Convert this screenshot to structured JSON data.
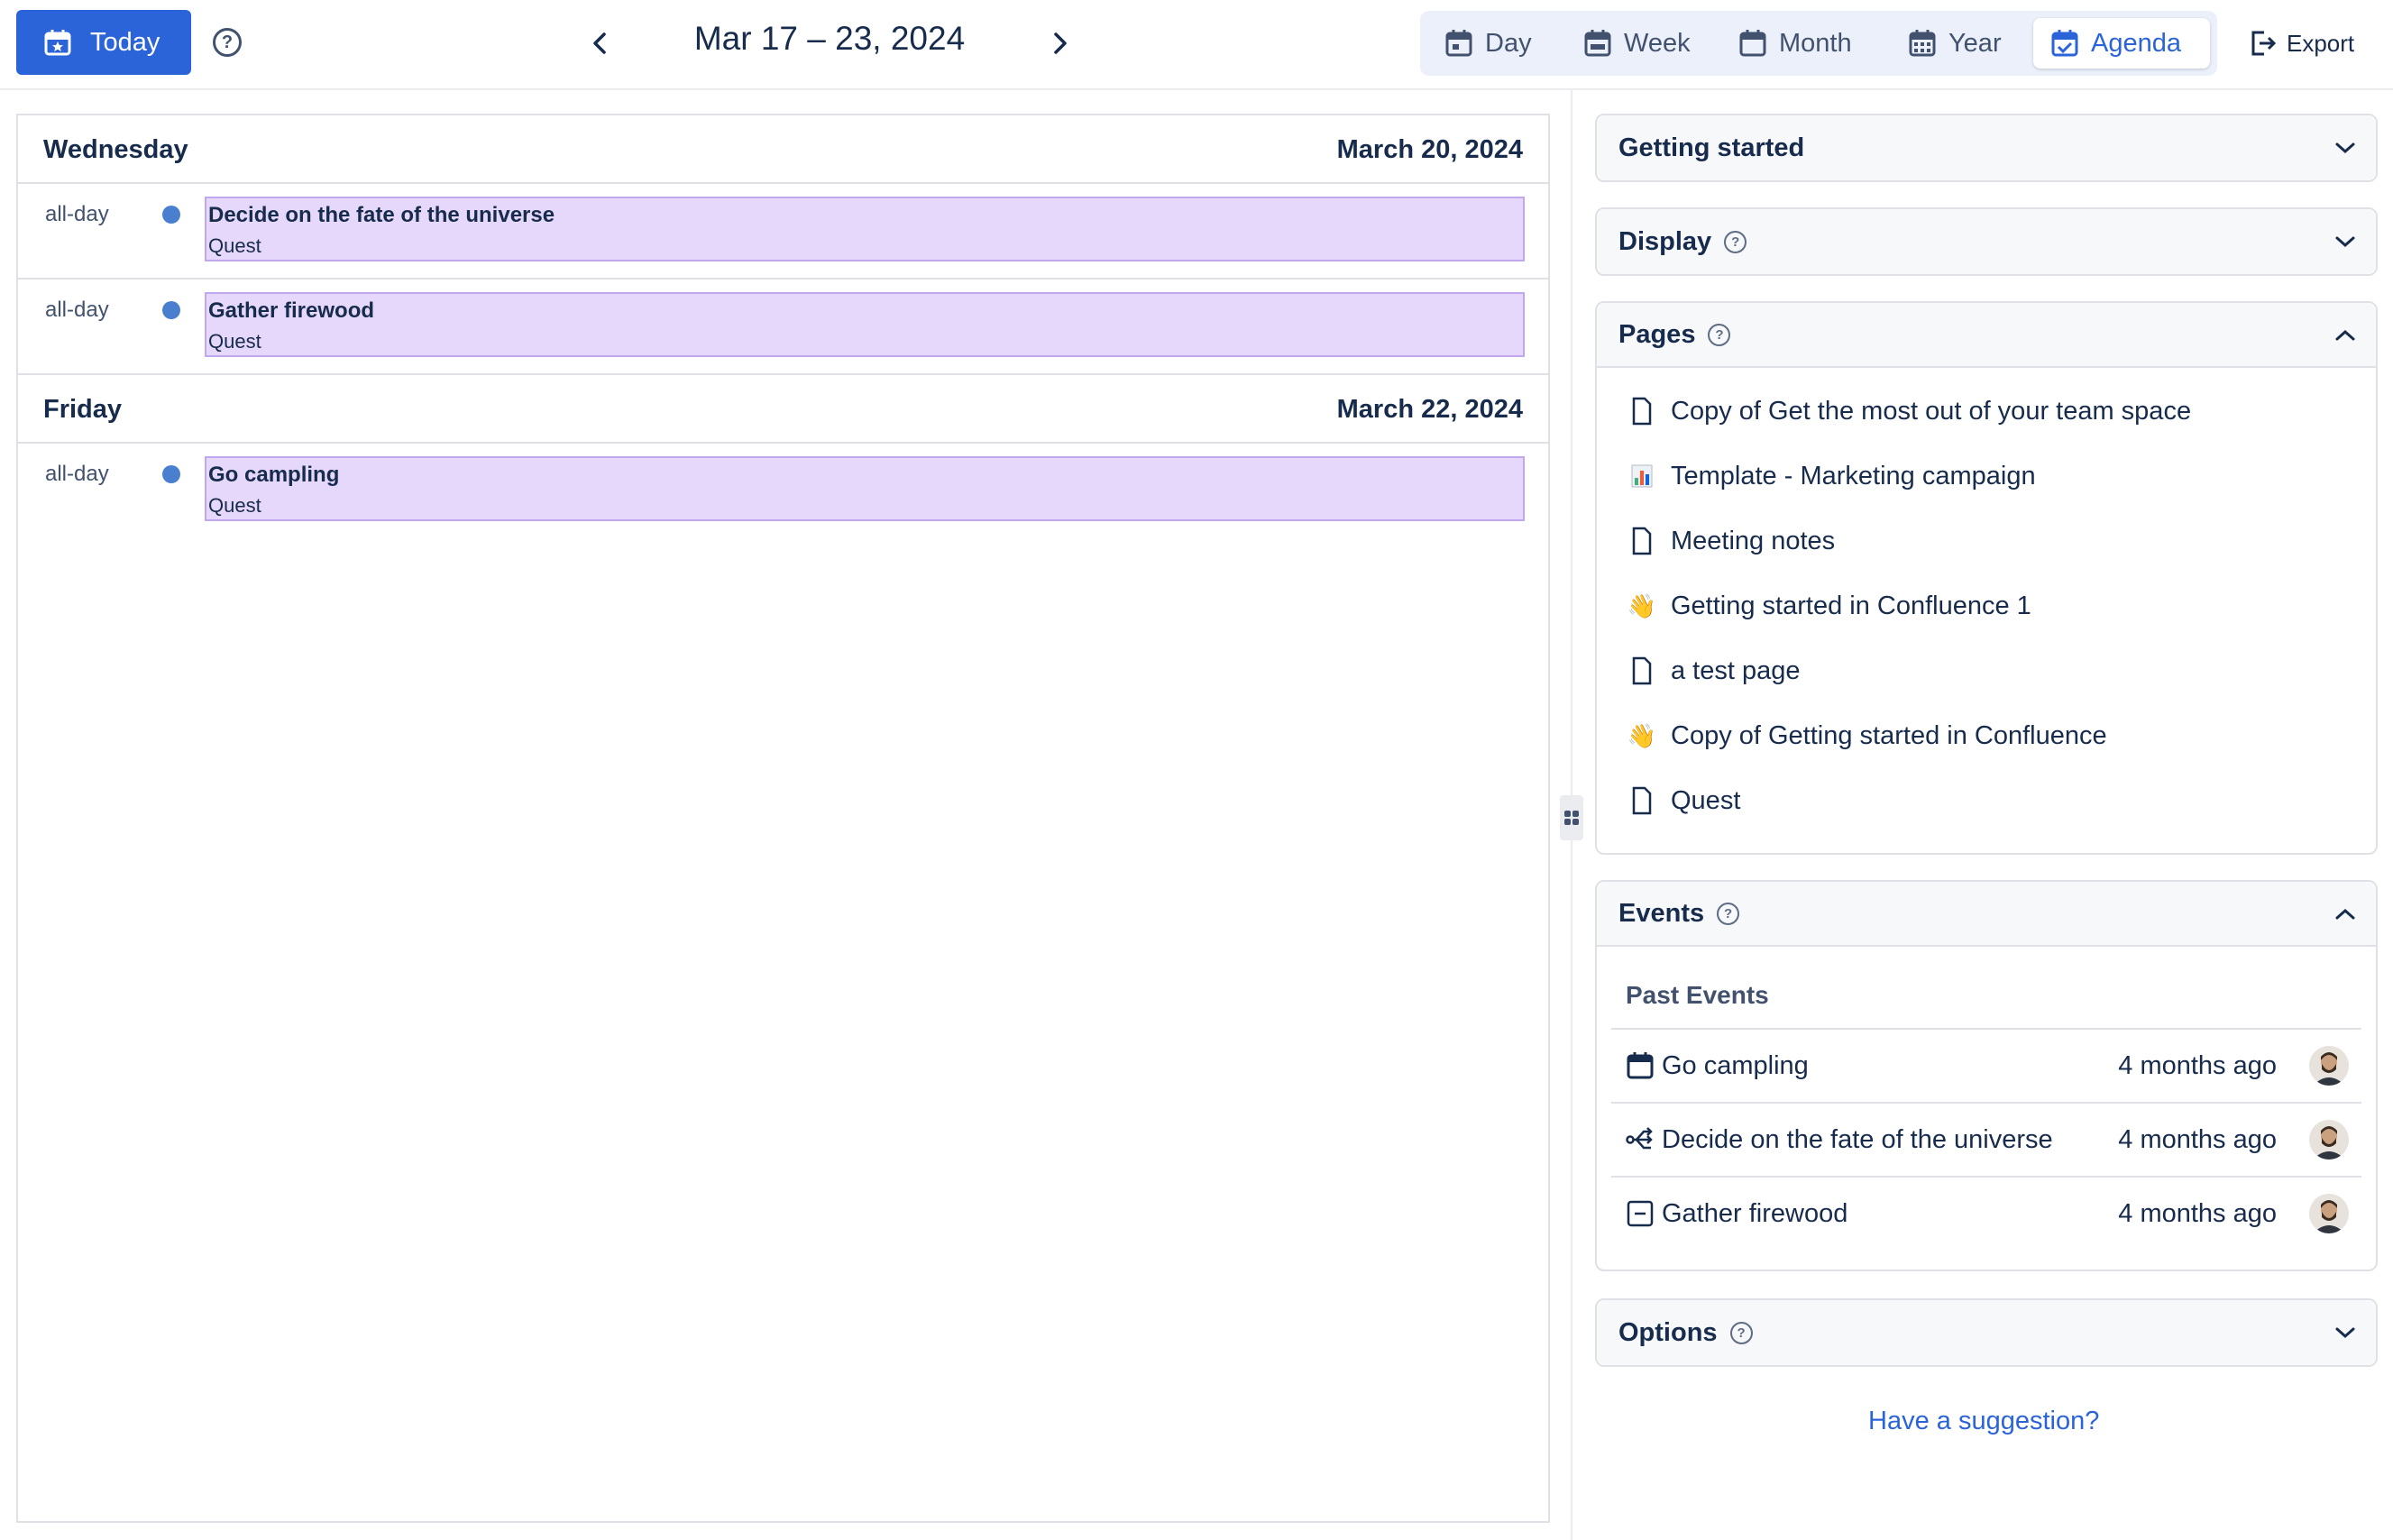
{
  "toolbar": {
    "today_label": "Today",
    "date_range": "Mar 17 – 23, 2024",
    "views": [
      {
        "label": "Day",
        "icon": "calendar-day-icon"
      },
      {
        "label": "Week",
        "icon": "calendar-week-icon"
      },
      {
        "label": "Month",
        "icon": "calendar-month-icon"
      },
      {
        "label": "Year",
        "icon": "calendar-year-icon"
      },
      {
        "label": "Agenda",
        "icon": "calendar-check-icon",
        "active": true
      }
    ],
    "export_label": "Export"
  },
  "agenda": {
    "days": [
      {
        "name": "Wednesday",
        "date": "March 20, 2024",
        "events": [
          {
            "time": "all-day",
            "title": "Decide on the fate of the universe",
            "calendar": "Quest"
          },
          {
            "time": "all-day",
            "title": "Gather firewood",
            "calendar": "Quest"
          }
        ]
      },
      {
        "name": "Friday",
        "date": "March 22, 2024",
        "events": [
          {
            "time": "all-day",
            "title": "Go campling",
            "calendar": "Quest"
          }
        ]
      }
    ]
  },
  "sidebar": {
    "getting_started": {
      "title": "Getting started",
      "expanded": false
    },
    "display": {
      "title": "Display",
      "expanded": false
    },
    "pages": {
      "title": "Pages",
      "expanded": true,
      "items": [
        {
          "label": "Copy of Get the most out of your team space",
          "icon": "page-icon"
        },
        {
          "label": "Template - Marketing campaign",
          "icon": "bar-chart-emoji",
          "glyph": "📊"
        },
        {
          "label": "Meeting notes",
          "icon": "page-icon"
        },
        {
          "label": "Getting started in Confluence 1",
          "icon": "wave-emoji",
          "glyph": "👋"
        },
        {
          "label": "a test page",
          "icon": "page-icon"
        },
        {
          "label": "Copy of Getting started in Confluence",
          "icon": "wave-emoji",
          "glyph": "👋"
        },
        {
          "label": "Quest",
          "icon": "page-icon"
        }
      ]
    },
    "events": {
      "title": "Events",
      "expanded": true,
      "past_title": "Past Events",
      "items": [
        {
          "name": "Go campling",
          "time": "4 months ago",
          "icon": "calendar-icon"
        },
        {
          "name": "Decide on the fate of the universe",
          "time": "4 months ago",
          "icon": "branch-icon"
        },
        {
          "name": "Gather firewood",
          "time": "4 months ago",
          "icon": "minus-square-icon"
        }
      ]
    },
    "options": {
      "title": "Options",
      "expanded": false
    },
    "suggestion_link": "Have a suggestion?"
  },
  "colors": {
    "accent": "#2b63d9",
    "event_fill": "#e6d8fb",
    "event_border": "#c1a8ee",
    "event_dot": "#4a7fd0"
  }
}
